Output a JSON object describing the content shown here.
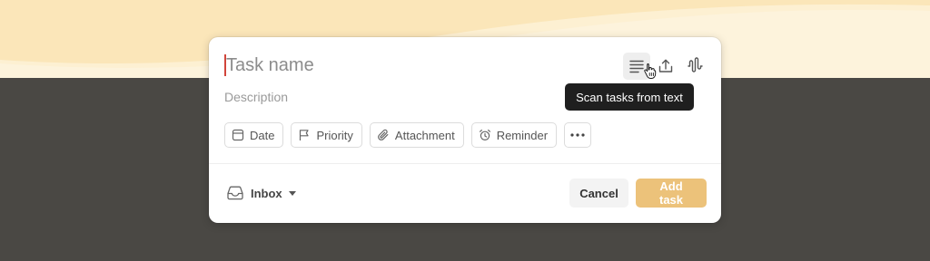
{
  "task": {
    "name_placeholder": "Task name",
    "description_placeholder": "Description"
  },
  "toolbar": {
    "icons": [
      "list-lines-icon",
      "upload-icon",
      "waveform-icon"
    ],
    "tooltip": "Scan tasks from text"
  },
  "chips": {
    "date": "Date",
    "priority": "Priority",
    "attachment": "Attachment",
    "reminder": "Reminder",
    "more_icon": "more-horizontal-icon"
  },
  "footer": {
    "project": "Inbox",
    "cancel": "Cancel",
    "add": "Add task"
  },
  "colors": {
    "background_top": "#fdf0d2",
    "background_bottom": "#4a4844",
    "caret": "#d1453b",
    "add_button": "#ecc27a",
    "tooltip": "#1f1f1f"
  }
}
